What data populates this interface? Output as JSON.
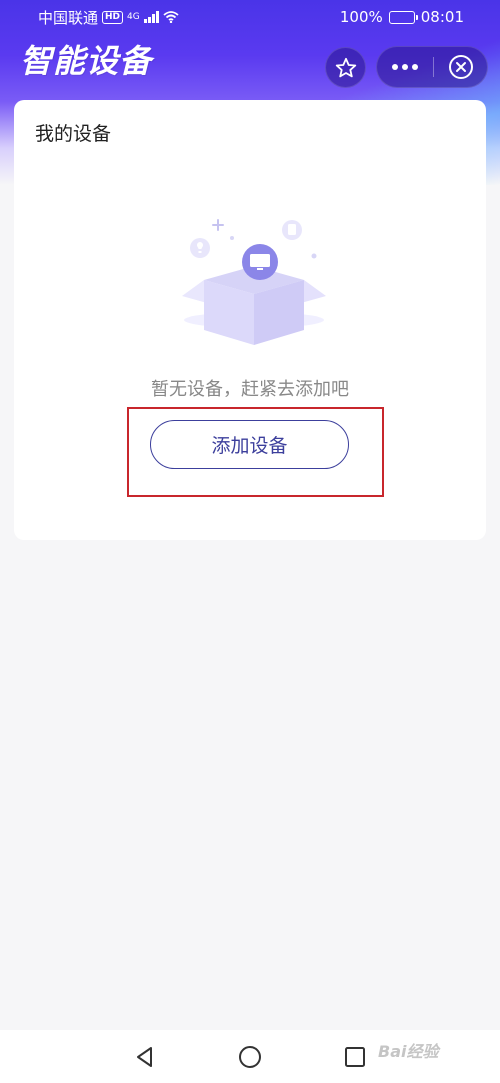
{
  "status_bar": {
    "carrier": "中国联通",
    "hd_badge": "HD",
    "network_type": "4G",
    "battery_percent": "100%",
    "time": "08:01"
  },
  "header": {
    "app_title": "智能设备"
  },
  "card": {
    "title": "我的设备",
    "empty_message": "暂无设备，赶紧去添加吧",
    "add_button_label": "添加设备"
  },
  "watermark": {
    "text": "Bai经验"
  },
  "colors": {
    "accent": "#3c3f9c",
    "header_purple": "#5a3af0",
    "highlight_red": "#c8262c"
  }
}
